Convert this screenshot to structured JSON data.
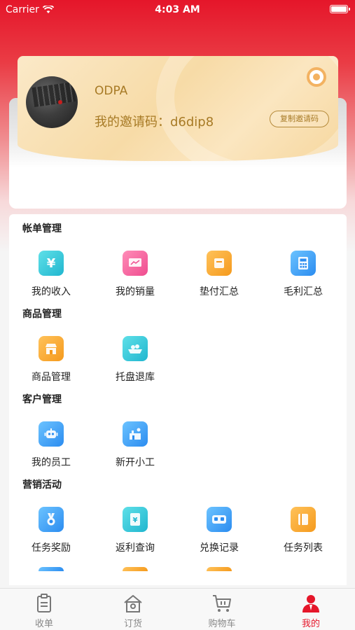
{
  "status_bar": {
    "carrier": "Carrier",
    "time": "4:03 AM"
  },
  "profile": {
    "name": "ODPA",
    "invite_text": "我的邀请码：d6dip8",
    "copy_button": "复制邀请码"
  },
  "sections": [
    {
      "title": "帐单管理",
      "items": [
        {
          "label": "我的收入",
          "icon": "yen-icon",
          "glyph": "¥"
        },
        {
          "label": "我的销量",
          "icon": "sales-chart-icon",
          "glyph": ""
        },
        {
          "label": "垫付汇总",
          "icon": "box-icon",
          "glyph": ""
        },
        {
          "label": "毛利汇总",
          "icon": "calculator-icon",
          "glyph": ""
        }
      ]
    },
    {
      "title": "商品管理",
      "items": [
        {
          "label": "商品管理",
          "icon": "store-icon",
          "glyph": ""
        },
        {
          "label": "托盘退库",
          "icon": "tray-icon",
          "glyph": ""
        }
      ]
    },
    {
      "title": "客户管理",
      "items": [
        {
          "label": "我的员工",
          "icon": "robot-icon",
          "glyph": ""
        },
        {
          "label": "新开小工",
          "icon": "new-staff-icon",
          "glyph": ""
        }
      ]
    },
    {
      "title": "营销活动",
      "items": [
        {
          "label": "任务奖励",
          "icon": "medal-icon",
          "glyph": ""
        },
        {
          "label": "返利查询",
          "icon": "rebate-icon",
          "glyph": ""
        },
        {
          "label": "兑换记录",
          "icon": "vr-goggles-icon",
          "glyph": ""
        },
        {
          "label": "任务列表",
          "icon": "book-icon",
          "glyph": ""
        }
      ]
    }
  ],
  "tabs": [
    {
      "label": "收单",
      "icon": "clipboard-icon"
    },
    {
      "label": "订货",
      "icon": "home-icon"
    },
    {
      "label": "购物车",
      "icon": "cart-icon"
    },
    {
      "label": "我的",
      "icon": "user-icon"
    }
  ],
  "colors": {
    "brand_red": "#e5162a",
    "gold_text": "#a77a25"
  }
}
